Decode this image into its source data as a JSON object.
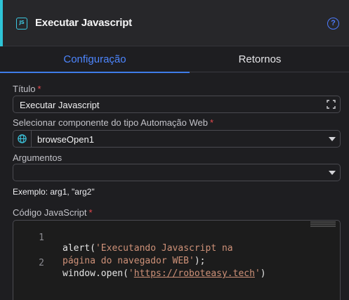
{
  "header": {
    "icon": "js-file-icon",
    "title": "Executar Javascript",
    "help_icon": "question-circle-icon",
    "accent_color": "#2ec4d6"
  },
  "tabs": [
    {
      "label": "Configuração",
      "active": true
    },
    {
      "label": "Retornos",
      "active": false
    }
  ],
  "form": {
    "title_label": "Título",
    "title_value": "Executar Javascript",
    "component_label": "Selecionar componente do tipo Automação Web",
    "component_value": "browseOpen1",
    "arguments_label": "Argumentos",
    "arguments_value": "",
    "example_hint": "Exemplo: arg1, \"arg2\"",
    "code_label": "Código JavaScript",
    "required_mark": "*"
  },
  "code": {
    "lines": [
      {
        "number": "1",
        "pre": "alert(",
        "str": "'Executando Javascript na",
        "post": ""
      },
      {
        "number": "",
        "pre": "",
        "str": "página do navegador WEB'",
        "post": ");"
      },
      {
        "number": "2",
        "pre": "window.open(",
        "str": "'https://roboteasy.tech'",
        "post": ")"
      }
    ],
    "url_text": "https://roboteasy.tech"
  },
  "colors": {
    "active_tab": "#4d86ff",
    "required": "#e5484d",
    "string": "#ce9178"
  }
}
